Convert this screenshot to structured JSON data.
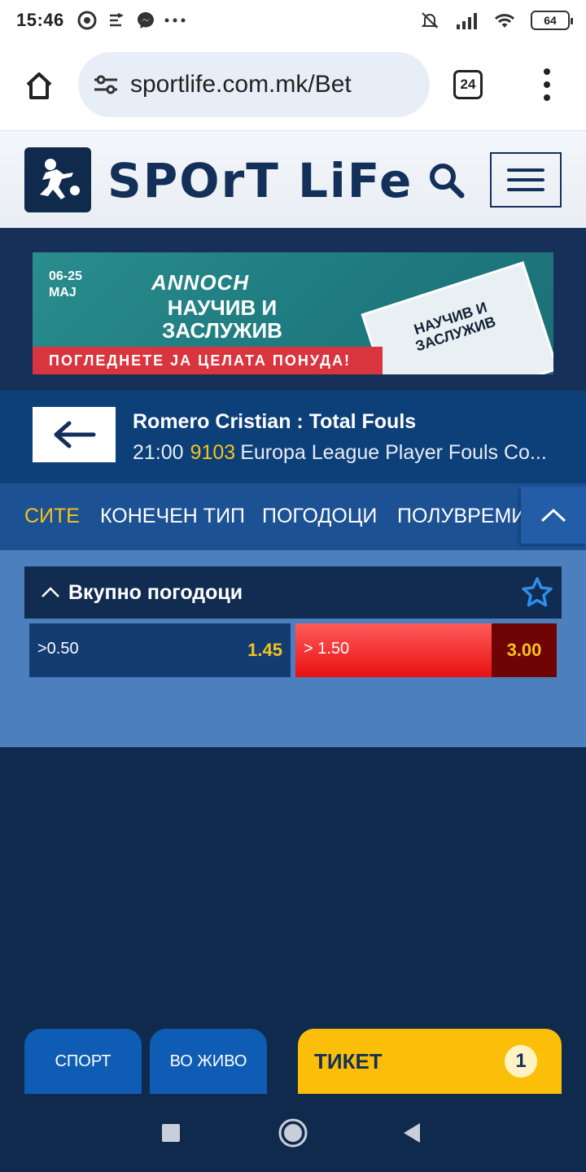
{
  "status_bar": {
    "time": "15:46",
    "battery": "64",
    "icons": [
      "chrome-icon",
      "sync-icon",
      "messenger-icon",
      "more-dots-icon",
      "mute-icon",
      "signal-icon",
      "wifi-icon",
      "battery-icon"
    ]
  },
  "browser": {
    "url": "sportlife.com.mk/Bet",
    "tab_count": "24"
  },
  "site": {
    "logo_text": "SPOrT LiFe"
  },
  "banner": {
    "dates_line1": "06-25",
    "dates_line2": "MAJ",
    "brand": "ANNOCH",
    "headline": "НАУЧИВ И ЗАСЛУЖИВ",
    "cta": "ПОГЛЕДНЕТЕ ЈА ЦЕЛАТА ПОНУДА!",
    "card_text": "НАУЧИВ И ЗАСЛУЖИВ"
  },
  "match": {
    "title": "Romero Cristian : Total Fouls",
    "time": "21:00",
    "code": "9103",
    "league": "Europa League Player Fouls Co..."
  },
  "tabs": [
    {
      "label": "СИТЕ",
      "active": true
    },
    {
      "label": "КОНЕЧЕН ТИП",
      "active": false
    },
    {
      "label": "ПОГОДОЦИ",
      "active": false
    },
    {
      "label": "ПОЛУВРЕМИ",
      "active": false
    }
  ],
  "market": {
    "title": "Вкупно погодоци",
    "odds": [
      {
        "label": ">0.50",
        "value": "1.45",
        "selected": false
      },
      {
        "label": "> 1.50",
        "value": "3.00",
        "selected": true
      }
    ]
  },
  "bottom_nav": {
    "sport": "СПОРТ",
    "live": "ВО ЖИВО",
    "ticket": "ТИКЕТ",
    "ticket_count": "1"
  },
  "colors": {
    "navy": "#0f2a4d",
    "accent_yellow": "#f7c21b",
    "selected_red": "#e81010",
    "tab_blue": "#1c5194"
  }
}
